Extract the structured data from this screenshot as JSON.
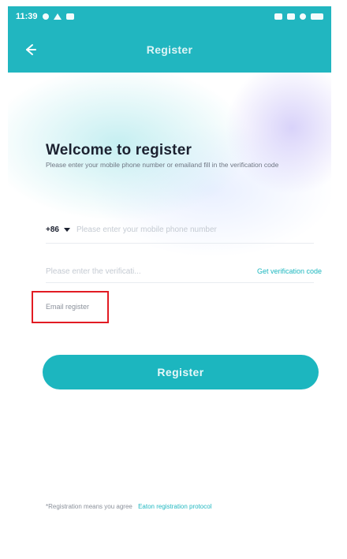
{
  "status_bar": {
    "time": "11:39",
    "icons": [
      "message-icon",
      "notification-icon",
      "image-icon"
    ],
    "right_icons": [
      "bluetooth-icon",
      "signal-icon",
      "wifi-icon",
      "battery-icon"
    ]
  },
  "nav": {
    "back_icon": "arrow-left-icon",
    "title": "Register"
  },
  "main": {
    "title": "Welcome to register",
    "subtitle": "Please enter your mobile phone number or emailand fill in the verification code"
  },
  "form": {
    "country_code": "+86",
    "phone_placeholder": "Please enter your mobile phone number",
    "code_placeholder": "Please enter the verificati...",
    "get_code_label": "Get verification code"
  },
  "links": {
    "email_register": "Email register"
  },
  "actions": {
    "register_label": "Register"
  },
  "footer": {
    "agreement_text": "*Registration means you agree",
    "agreement_link": "Eaton registration protocol"
  },
  "colors": {
    "brand": "#21b6c0",
    "button": "#1cb6bf",
    "highlight": "#e21b23"
  }
}
